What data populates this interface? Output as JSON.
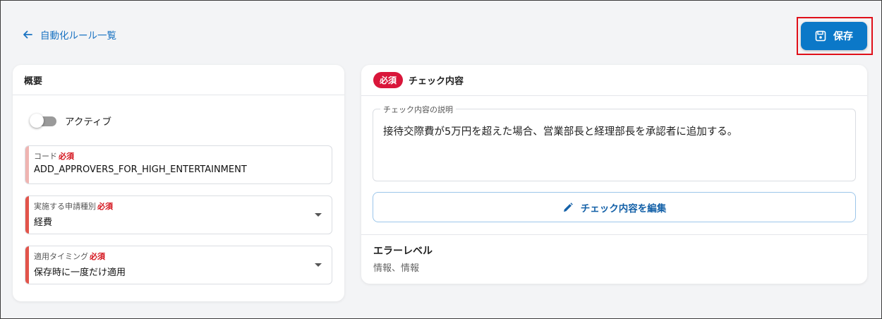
{
  "header": {
    "back_label": "自動化ルール一覧",
    "save_label": "保存"
  },
  "overview": {
    "title": "概要",
    "active_label": "アクティブ",
    "fields": [
      {
        "label": "コード",
        "required": "必須",
        "value": "ADD_APPROVERS_FOR_HIGH_ENTERTAINMENT"
      },
      {
        "label": "実施する申請種別",
        "required": "必須",
        "value": "経費"
      },
      {
        "label": "適用タイミング",
        "required": "必須",
        "value": "保存時に一度だけ適用"
      }
    ]
  },
  "check": {
    "required_badge": "必須",
    "title": "チェック内容",
    "description_label": "チェック内容の説明",
    "description": "接待交際費が5万円を超えた場合、営業部長と経理部長を承認者に追加する。",
    "edit_label": "チェック内容を編集",
    "error_level_title": "エラーレベル",
    "error_level_value": "情報、情報"
  },
  "colors": {
    "accent": "#0b78c8",
    "required": "#d9163a",
    "link": "#1a73c2"
  }
}
